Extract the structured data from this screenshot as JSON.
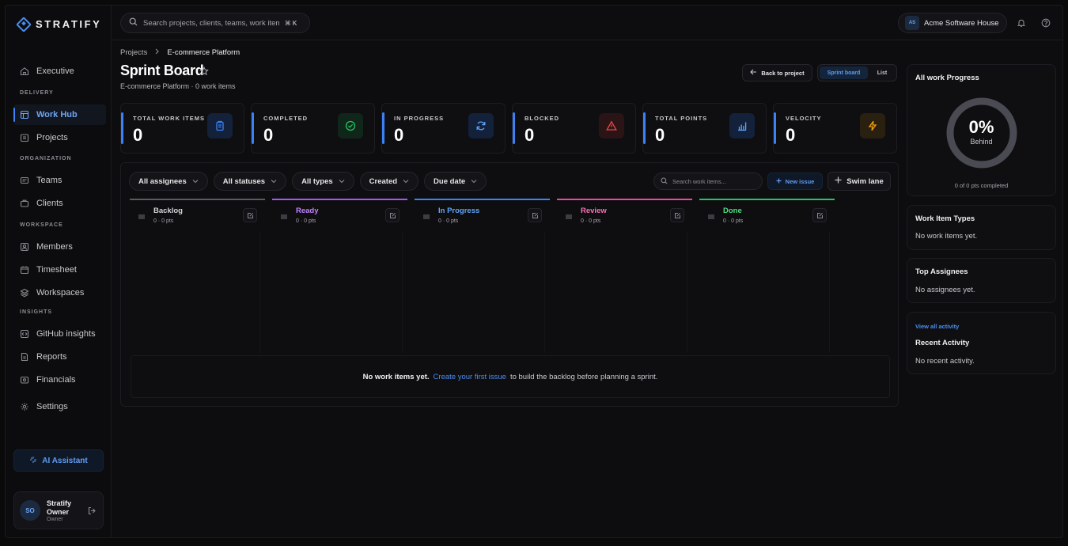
{
  "brand": {
    "name": "STRATIFY"
  },
  "topbar": {
    "search_placeholder": "Search projects, clients, teams, work items...",
    "shortcut": "⌘ K",
    "org_initials": "AS",
    "org_name": "Acme Software House"
  },
  "sidebar": {
    "executive": "Executive",
    "sections": {
      "delivery": "DELIVERY",
      "organization": "ORGANIZATION",
      "workspace": "WORKSPACE",
      "insights": "INSIGHTS"
    },
    "items": {
      "work_hub": "Work Hub",
      "projects": "Projects",
      "teams": "Teams",
      "clients": "Clients",
      "members": "Members",
      "timesheet": "Timesheet",
      "workspaces": "Workspaces",
      "github": "GitHub insights",
      "reports": "Reports",
      "financials": "Financials",
      "settings": "Settings"
    },
    "ai_assistant": "AI Assistant",
    "user": {
      "initials": "SO",
      "name_line1": "Stratify",
      "name_line2": "Owner",
      "role": "Owner"
    }
  },
  "main": {
    "breadcrumb": [
      "Projects",
      "E-commerce Platform"
    ],
    "title": "Sprint Board",
    "subtitle": "E-commerce Platform · 0 work items",
    "back_button": "Back to project",
    "view_options": [
      "Sprint board",
      "List"
    ],
    "active_view": "Sprint board"
  },
  "stats": [
    {
      "label": "TOTAL WORK ITEMS",
      "value": "0",
      "icon": "clipboard-icon",
      "color": "#3b82f6",
      "bg": "#14213a"
    },
    {
      "label": "COMPLETED",
      "value": "0",
      "icon": "check-circle-icon",
      "color": "#22c55e",
      "bg": "#10261a"
    },
    {
      "label": "IN PROGRESS",
      "value": "0",
      "icon": "refresh-icon",
      "color": "#60a5fa",
      "bg": "#14213a"
    },
    {
      "label": "BLOCKED",
      "value": "0",
      "icon": "warning-icon",
      "color": "#ef4444",
      "bg": "#2a1416"
    },
    {
      "label": "TOTAL POINTS",
      "value": "0",
      "icon": "bar-chart-icon",
      "color": "#60a5fa",
      "bg": "#14213a"
    },
    {
      "label": "VELOCITY",
      "value": "0",
      "icon": "lightning-icon",
      "color": "#f59e0b",
      "bg": "#2a2010"
    }
  ],
  "filters": [
    "All assignees",
    "All statuses",
    "All types",
    "Created",
    "Due date"
  ],
  "board": {
    "search_placeholder": "Search work items...",
    "new_issue": "New issue",
    "swim_lane": "Swim lane",
    "columns": [
      {
        "title": "Backlog",
        "meta": "0 · 0 pts",
        "color": "#d4d4d8",
        "bar": "#5a5a62"
      },
      {
        "title": "Ready",
        "meta": "0 · 0 pts",
        "color": "#c084fc",
        "bar": "#a855f7"
      },
      {
        "title": "In Progress",
        "meta": "0 · 0 pts",
        "color": "#60a5fa",
        "bar": "#3b82f6"
      },
      {
        "title": "Review",
        "meta": "0 · 0 pts",
        "color": "#f472b6",
        "bar": "#ec4899"
      },
      {
        "title": "Done",
        "meta": "0 · 0 pts",
        "color": "#4ade80",
        "bar": "#22c55e"
      }
    ],
    "empty": {
      "bold": "No work items yet.",
      "link": "Create your first issue",
      "rest": "to build the backlog before planning a sprint."
    }
  },
  "right_panel": {
    "progress": {
      "title": "All work Progress",
      "percent": "0%",
      "status": "Behind",
      "footer": "0 of 0 pts completed",
      "fraction": 0
    },
    "types": {
      "title": "Work Item Types",
      "empty": "No work items yet."
    },
    "assignees": {
      "title": "Top Assignees",
      "empty": "No assignees yet."
    },
    "activity": {
      "link": "View all activity",
      "title": "Recent Activity",
      "empty": "No recent activity."
    }
  }
}
